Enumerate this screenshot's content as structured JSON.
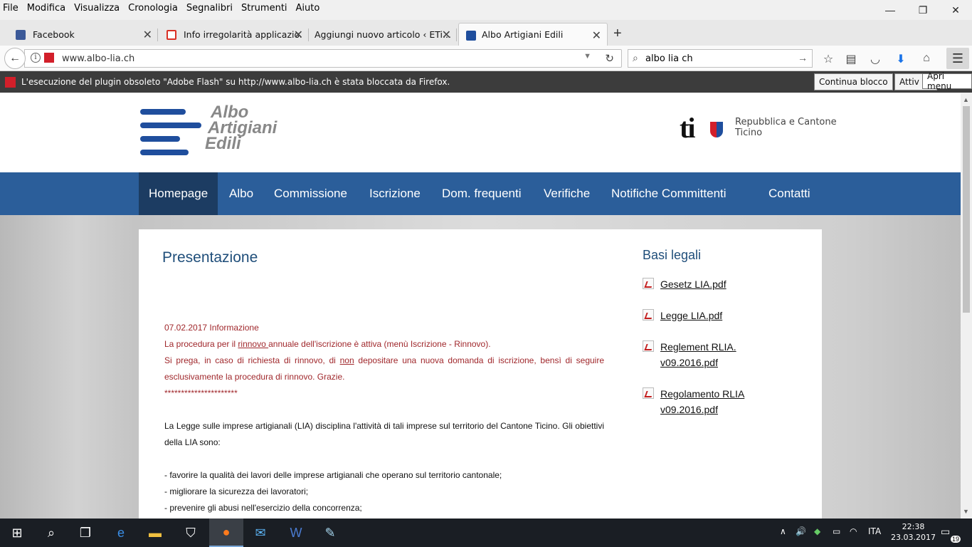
{
  "menubar": {
    "items": [
      "File",
      "Modifica",
      "Visualizza",
      "Cronologia",
      "Segnalibri",
      "Strumenti",
      "Aiuto"
    ]
  },
  "window_controls": {
    "minimize": "—",
    "restore": "❐",
    "close": "✕"
  },
  "tabs": [
    {
      "label": "Facebook",
      "favicon_color": "#3b5998"
    },
    {
      "label": "Info irregolarità applicazio...",
      "favicon_color": "#d93025"
    },
    {
      "label": "Aggiungi nuovo articolo ‹ ETi...",
      "favicon_color": ""
    },
    {
      "label": "Albo Artigiani Edili",
      "favicon_color": "#1f4e9d"
    }
  ],
  "navbar": {
    "url": "www.albo-lia.ch",
    "search_value": "albo lia ch"
  },
  "notification": {
    "text": "L'esecuzione del plugin obsoleto \"Adobe Flash\" su http://www.albo-lia.ch è stata bloccata da Firefox.",
    "continue_button": "Continua blocco",
    "allow_button": "Attiv",
    "tooltip": "Apri menu"
  },
  "site": {
    "logo_lines": [
      "Albo",
      "Artigiani",
      "Edili"
    ],
    "ti_logo": "ti",
    "ti_text_1": "Repubblica e Cantone",
    "ti_text_2": "Ticino",
    "nav": [
      "Homepage",
      "Albo",
      "Commissione",
      "Iscrizione",
      "Dom. frequenti",
      "Verifiche",
      "Notifiche Committenti",
      "Contatti"
    ],
    "brand_color": "#2b5e9a"
  },
  "content": {
    "title": "Presentazione",
    "info_date": "07.02.2017 Informazione",
    "info_l1_a": "La procedura per il ",
    "info_l1_u": "rinnovo ",
    "info_l1_b": "annuale dell'iscrizione è attiva (menù Iscrizione - Rinnovo).",
    "info_l2_a": "Si prega, in caso di richiesta di rinnovo, di ",
    "info_l2_u": "non",
    "info_l2_b": " depositare una nuova domanda di iscrizione, bensì di seguire esclusivamente la procedura di rinnovo. Grazie.",
    "stars": "**********************",
    "para1": "La Legge sulle imprese artigianali (LIA) disciplina l'attività di tali imprese sul territorio del Cantone Ticino. Gli obiettivi della LIA sono:",
    "bullets": [
      "- favorire la qualità dei lavori delle imprese artigianali che operano sul territorio cantonale;",
      "- migliorare la sicurezza dei lavoratori;",
      "- prevenire gli abusi nell'esercizio della concorrenza;"
    ],
    "legal_title": "Basi legali",
    "pdfs": [
      {
        "l1": "Gesetz LIA.pdf",
        "l2": ""
      },
      {
        "l1": "Legge LIA.pdf",
        "l2": ""
      },
      {
        "l1": "Reglement RLIA.",
        "l2": "v09.2016.pdf"
      },
      {
        "l1": "Regolamento RLIA",
        "l2": "v09.2016.pdf"
      }
    ]
  },
  "taskbar": {
    "lang": "ITA",
    "time": "22:38",
    "date": "23.03.2017",
    "notif_count": "19"
  }
}
